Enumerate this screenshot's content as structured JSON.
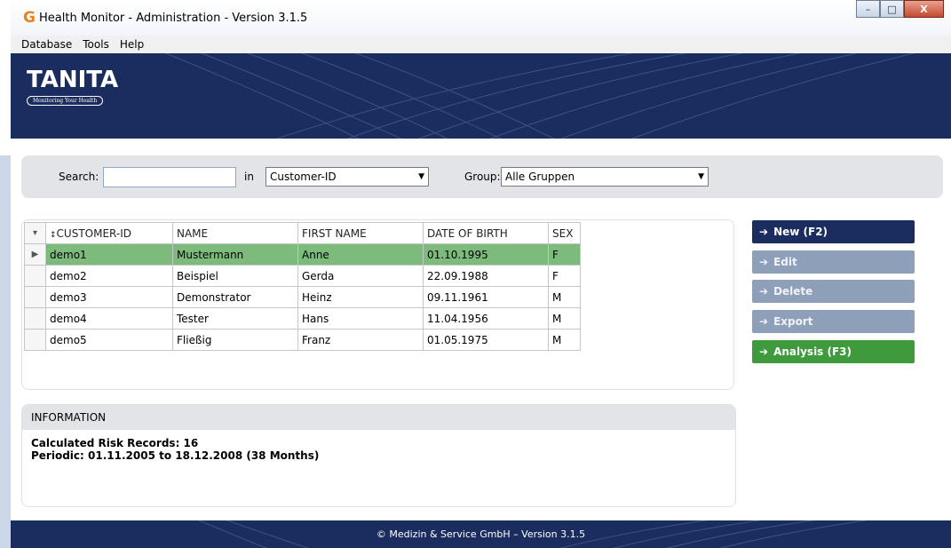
{
  "window": {
    "title": "Health Monitor - Administration - Version 3.1.5",
    "app_icon_glyph": "G",
    "controls": {
      "minimize": "–",
      "maximize": "□",
      "close": "X"
    }
  },
  "menu": [
    "Database",
    "Tools",
    "Help"
  ],
  "brand": {
    "logo": "TANITA",
    "tagline": "Monitoring Your Health"
  },
  "search": {
    "label": "Search:",
    "value": "",
    "in_label": "in",
    "field_select": "Customer-ID",
    "group_label": "Group:",
    "group_select": "Alle Gruppen"
  },
  "table": {
    "sort_glyph": "▾",
    "columns": [
      "CUSTOMER-ID",
      "NAME",
      "FIRST NAME",
      "DATE OF BIRTH",
      "SEX"
    ],
    "selected_row_marker": "▶",
    "rows": [
      [
        "demo1",
        "Mustermann",
        "Anne",
        "01.10.1995",
        "F"
      ],
      [
        "demo2",
        "Beispiel",
        "Gerda",
        "22.09.1988",
        "F"
      ],
      [
        "demo3",
        "Demonstrator",
        "Heinz",
        "09.11.1961",
        "M"
      ],
      [
        "demo4",
        "Tester",
        "Hans",
        "11.04.1956",
        "M"
      ],
      [
        "demo5",
        "Fließig",
        "Franz",
        "01.05.1975",
        "M"
      ]
    ]
  },
  "actions": {
    "arrow": "➔",
    "new": "New (F2)",
    "edit": "Edit",
    "delete": "Delete",
    "export": "Export",
    "analysis": "Analysis (F3)"
  },
  "info": {
    "header": "INFORMATION",
    "line1": "Calculated Risk Records: 16",
    "line2": "Periodic: 01.11.2005 to 18.12.2008 (38 Months)"
  },
  "footer": {
    "text": "© Medizin & Service GmbH – Version 3.1.5"
  },
  "colors": {
    "navy": "#1b2d5e",
    "selected_row": "#7dbb7d",
    "analysis_green": "#3f9a3d",
    "disabled_button": "#8e9fba"
  }
}
